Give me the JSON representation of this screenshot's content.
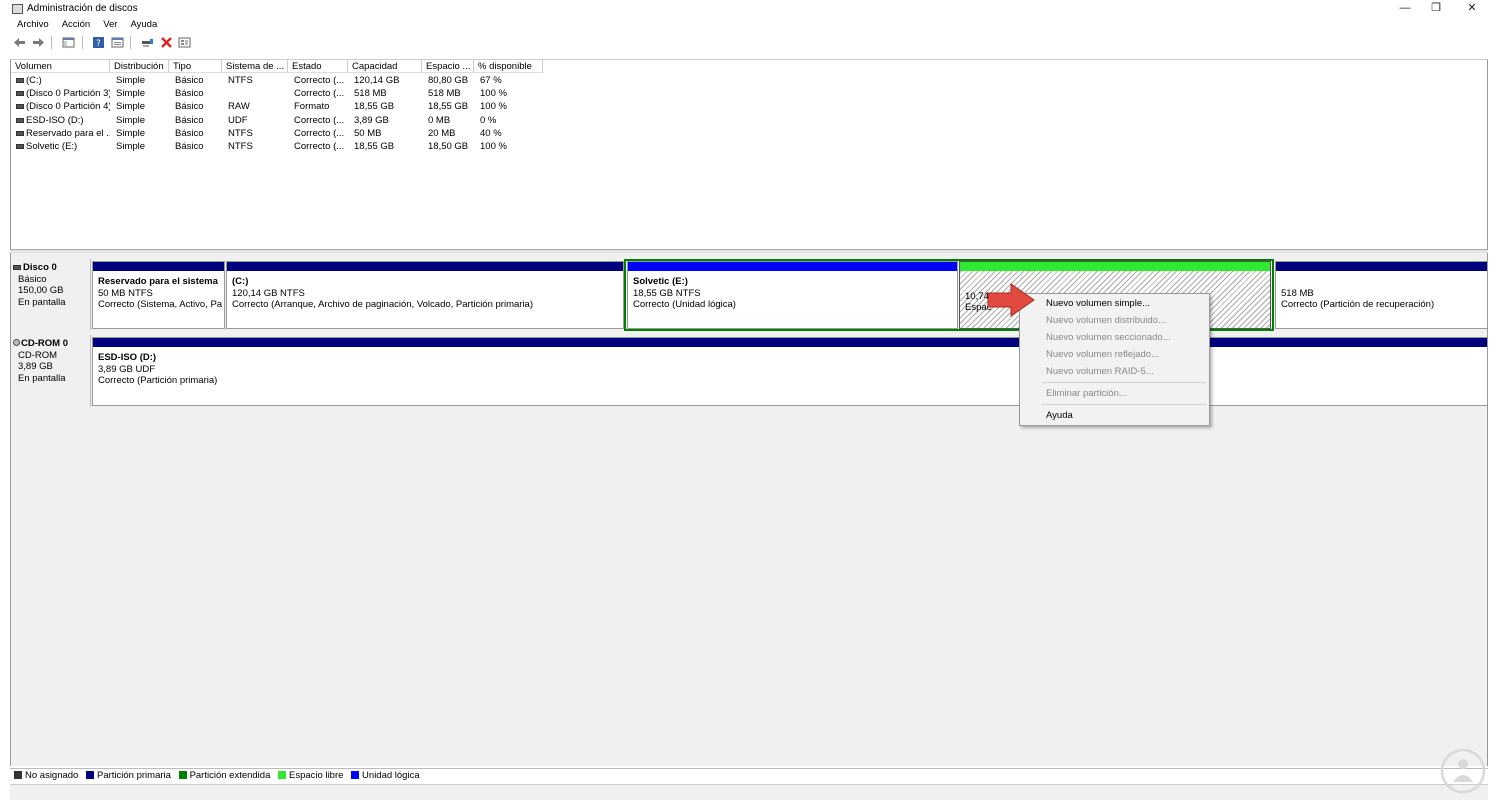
{
  "window": {
    "title": "Administración de discos",
    "controls": {
      "minimize": "—",
      "restore": "❐",
      "close": "✕"
    }
  },
  "menubar": [
    "Archivo",
    "Acción",
    "Ver",
    "Ayuda"
  ],
  "toolbar": {
    "icons": [
      "back-icon",
      "forward-icon",
      "show-hide-console-tree-icon",
      "help-icon",
      "properties-icon",
      "connect-icon",
      "delete-icon",
      "view-icon"
    ]
  },
  "volume_list": {
    "columns": [
      "Volumen",
      "Distribución",
      "Tipo",
      "Sistema de ...",
      "Estado",
      "Capacidad",
      "Espacio ...",
      "% disponible"
    ],
    "rows": [
      [
        "(C:)",
        "Simple",
        "Básico",
        "NTFS",
        "Correcto (...",
        "120,14 GB",
        "80,80 GB",
        "67 %"
      ],
      [
        "(Disco 0 Partición 3)",
        "Simple",
        "Básico",
        "",
        "Correcto (...",
        "518 MB",
        "518 MB",
        "100 %"
      ],
      [
        "(Disco 0 Partición 4)",
        "Simple",
        "Básico",
        "RAW",
        "Formato",
        "18,55 GB",
        "18,55 GB",
        "100 %"
      ],
      [
        "ESD-ISO (D:)",
        "Simple",
        "Básico",
        "UDF",
        "Correcto (...",
        "3,89 GB",
        "0 MB",
        "0 %"
      ],
      [
        "Reservado para el ...",
        "Simple",
        "Básico",
        "NTFS",
        "Correcto (...",
        "50 MB",
        "20 MB",
        "40 %"
      ],
      [
        "Solvetic (E:)",
        "Simple",
        "Básico",
        "NTFS",
        "Correcto (...",
        "18,55 GB",
        "18,50 GB",
        "100 %"
      ]
    ]
  },
  "disks": [
    {
      "name": "Disco 0",
      "type": "Básico",
      "size": "150,00 GB",
      "status": "En pantalla",
      "partitions": [
        {
          "title": "Reservado para el sistema",
          "size": "50 MB NTFS",
          "state": "Correcto (Sistema, Activo, Par"
        },
        {
          "title": "(C:)",
          "size": "120,14 GB NTFS",
          "state": "Correcto (Arranque, Archivo de paginación, Volcado, Partición primaria)"
        },
        {
          "title": "Solvetic  (E:)",
          "size": "18,55 GB NTFS",
          "state": "Correcto (Unidad lógica)"
        },
        {
          "title": "",
          "size": "10,74",
          "state": "Espac"
        },
        {
          "title": "",
          "size": "518 MB",
          "state": "Correcto (Partición de recuperación)"
        }
      ]
    },
    {
      "name": "CD-ROM 0",
      "type": "CD-ROM",
      "size": "3,89 GB",
      "status": "En pantalla",
      "partitions": [
        {
          "title": "ESD-ISO  (D:)",
          "size": "3,89 GB UDF",
          "state": "Correcto (Partición primaria)"
        }
      ]
    }
  ],
  "context_menu": {
    "items": [
      {
        "label": "Nuevo volumen simple...",
        "enabled": true
      },
      {
        "label": "Nuevo volumen distribuido...",
        "enabled": false
      },
      {
        "label": "Nuevo volumen seccionado...",
        "enabled": false
      },
      {
        "label": "Nuevo volumen reflejado...",
        "enabled": false
      },
      {
        "label": "Nuevo volumen RAID-5...",
        "enabled": false
      },
      {
        "label": "Eliminar partición...",
        "enabled": false
      },
      {
        "label": "Ayuda",
        "enabled": true
      }
    ]
  },
  "legend": [
    {
      "label": "No asignado",
      "color": "#333333"
    },
    {
      "label": "Partición primaria",
      "color": "#00007f"
    },
    {
      "label": "Partición extendida",
      "color": "#008000"
    },
    {
      "label": "Espacio libre",
      "color": "#33e833"
    },
    {
      "label": "Unidad lógica",
      "color": "#0000ff"
    }
  ],
  "colors": {
    "primary_partition": "#00007f",
    "logical_drive": "#0000ff",
    "free_space": "#33e833",
    "extended_border": "#008000",
    "arrow": "#e04a3f"
  }
}
